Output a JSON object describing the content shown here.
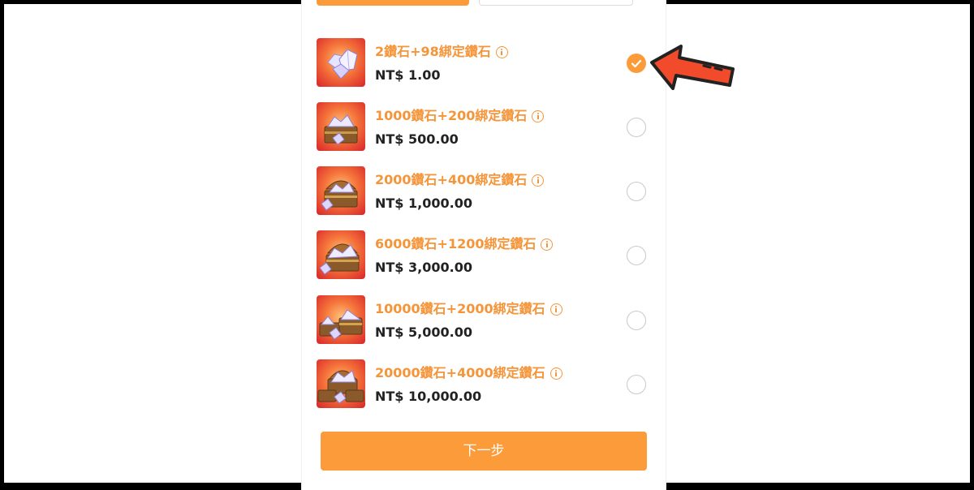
{
  "colors": {
    "accent": "#fb9b3a",
    "name_text": "#f5953a",
    "price_text": "#222222",
    "annotation_arrow": "#f14b2c"
  },
  "packages": [
    {
      "name": "2鑽石+98綁定鑽石",
      "price": "NT$ 1.00",
      "selected": true,
      "icon": "diamond-pile-icon"
    },
    {
      "name": "1000鑽石+200綁定鑽石",
      "price": "NT$ 500.00",
      "selected": false,
      "icon": "diamond-chest-icon"
    },
    {
      "name": "2000鑽石+400綁定鑽石",
      "price": "NT$ 1,000.00",
      "selected": false,
      "icon": "diamond-chest-icon"
    },
    {
      "name": "6000鑽石+1200綁定鑽石",
      "price": "NT$ 3,000.00",
      "selected": false,
      "icon": "diamond-chest-icon"
    },
    {
      "name": "10000鑽石+2000綁定鑽石",
      "price": "NT$ 5,000.00",
      "selected": false,
      "icon": "diamond-chests-icon"
    },
    {
      "name": "20000鑽石+4000綁定鑽石",
      "price": "NT$ 10,000.00",
      "selected": false,
      "icon": "diamond-chests-icon"
    }
  ],
  "next_button_label": "下一步",
  "annotation": {
    "icon": "pointer-arrow-icon"
  }
}
